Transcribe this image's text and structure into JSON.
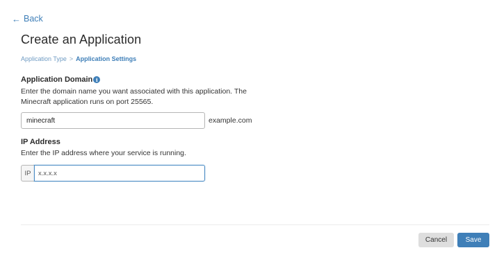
{
  "nav": {
    "back_label": "Back",
    "back_arrow": "←"
  },
  "page": {
    "title": "Create an Application"
  },
  "breadcrumb": {
    "step1": "Application Type",
    "separator": ">",
    "step2": "Application Settings"
  },
  "domain_section": {
    "label": "Application Domain",
    "info_icon": "i",
    "description": "Enter the domain name you want associated with this application. The Minecraft application runs on port 25565.",
    "input_value": "minecraft",
    "suffix": "example.com"
  },
  "ip_section": {
    "label": "IP Address",
    "description": "Enter the IP address where your service is running.",
    "prefix": "IP",
    "placeholder": "x.x.x.x"
  },
  "actions": {
    "cancel_label": "Cancel",
    "save_label": "Save"
  },
  "colors": {
    "accent": "#3f7fb8",
    "cancel_bg": "#dedede"
  }
}
